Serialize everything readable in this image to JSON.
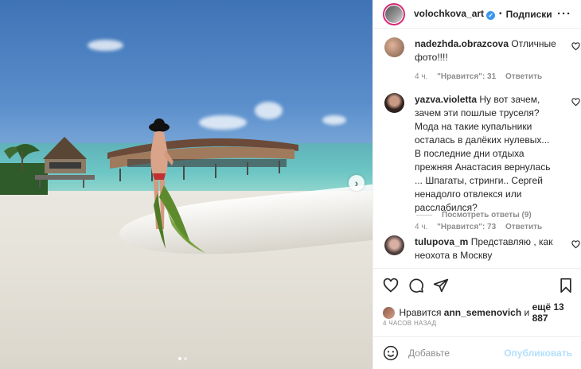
{
  "post": {
    "username": "volochkova_art",
    "separator": "•",
    "follow_label": "Подписки",
    "more_icon": "more-dots-icon"
  },
  "comments": [
    {
      "username": "nadezhda.obrazcova",
      "text": "Отличные фото!!!!",
      "time": "4 ч.",
      "likes": "\"Нравится\": 31",
      "reply_label": "Ответить",
      "avatar_color": "#b5866a"
    },
    {
      "username": "yazva.violetta",
      "text": "Ну вот зачем, зачем эти пошлые труселя? Мода на такие купальники осталась в далёких нулевых... В последние дни отдыха прежняя Анастасия вернулась ... Шпагаты, стринги.. Сергей ненадолго отвлекся или расслабился?",
      "time": "4 ч.",
      "likes": "\"Нравится\": 73",
      "reply_label": "Ответить",
      "avatar_color": "#3a2a26"
    },
    {
      "username": "tulupova_m",
      "text": "Представляю , как неохота в Москву",
      "avatar_color": "#6b5a58"
    }
  ],
  "view_replies": "Посмотреть ответы (9)",
  "liked_by": {
    "prefix": "Нравится",
    "user": "ann_semenovich",
    "middle": "и",
    "others": "ещё 13 887"
  },
  "time_ago": "4 ЧАСОВ НАЗАД",
  "add_comment": {
    "placeholder": "Добавьте",
    "publish_label": "Опубликовать"
  },
  "colors": {
    "verified": "#3897f0",
    "publish_disabled": "#b2dffc",
    "story_ring": "#d62976"
  }
}
